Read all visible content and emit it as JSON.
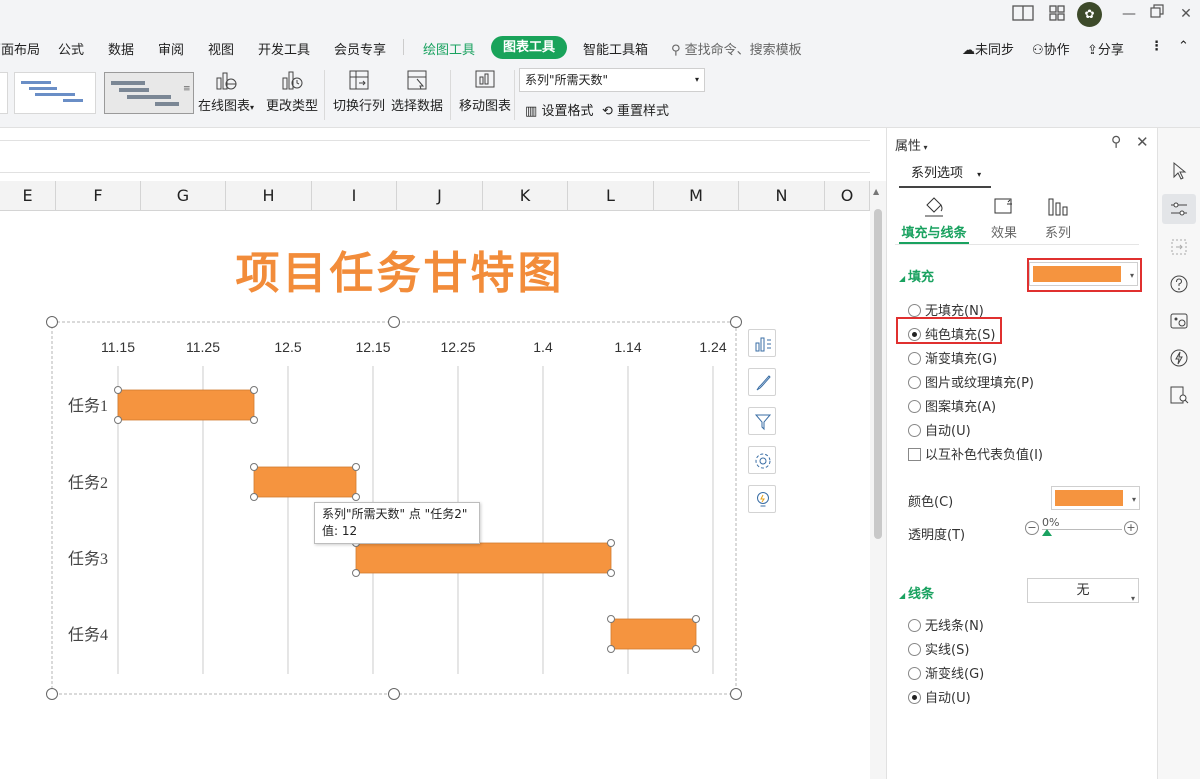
{
  "titlebar": {
    "user_initial": "✿"
  },
  "menu": {
    "items": [
      "页面布局",
      "公式",
      "数据",
      "审阅",
      "视图",
      "开发工具",
      "会员专享"
    ],
    "drawing_tools": "绘图工具",
    "chart_tools": "图表工具",
    "smart_toolbox": "智能工具箱",
    "search_placeholder": "查找命令、搜索模板",
    "unsynced": "未同步",
    "collaborate": "协作",
    "share": "分享"
  },
  "toolbar": {
    "online_chart": "在线图表",
    "change_type": "更改类型",
    "switch_rowcol": "切换行列",
    "select_data": "选择数据",
    "move_chart": "移动图表",
    "series_select": "系列\"所需天数\"",
    "set_format": "设置格式",
    "reset_style": "重置样式"
  },
  "columns": [
    "E",
    "F",
    "G",
    "H",
    "I",
    "J",
    "K",
    "L",
    "M",
    "N",
    "O"
  ],
  "chart_data": {
    "type": "bar",
    "title": "项目任务甘特图",
    "accent_color": "#f5943f",
    "x_tick_labels": [
      "11.15",
      "11.25",
      "12.5",
      "12.15",
      "12.25",
      "1.4",
      "1.14",
      "1.24"
    ],
    "categories": [
      "任务1",
      "任务2",
      "任务3",
      "任务4"
    ],
    "series": [
      {
        "start": [
          "11.15",
          "12.1",
          "12.13",
          "1.12"
        ],
        "values": [
          16,
          12,
          30,
          10
        ]
      }
    ],
    "tooltip": {
      "line1": "系列\"所需天数\" 点 \"任务2\"",
      "line2": "值: 12"
    }
  },
  "panel": {
    "title": "属性",
    "series_options": "系列选项",
    "tabs": [
      "填充与线条",
      "效果",
      "系列"
    ],
    "fill_section": "填充",
    "fill_options": [
      "无填充(N)",
      "纯色填充(S)",
      "渐变填充(G)",
      "图片或纹理填充(P)",
      "图案填充(A)",
      "自动(U)"
    ],
    "invert_negative": "以互补色代表负值(I)",
    "color_label": "颜色(C)",
    "transparency_label": "透明度(T)",
    "transparency_value": "0%",
    "line_section": "线条",
    "line_value": "无",
    "line_options": [
      "无线条(N)",
      "实线(S)",
      "渐变线(G)",
      "自动(U)"
    ],
    "fill_color": "#f5943f"
  }
}
